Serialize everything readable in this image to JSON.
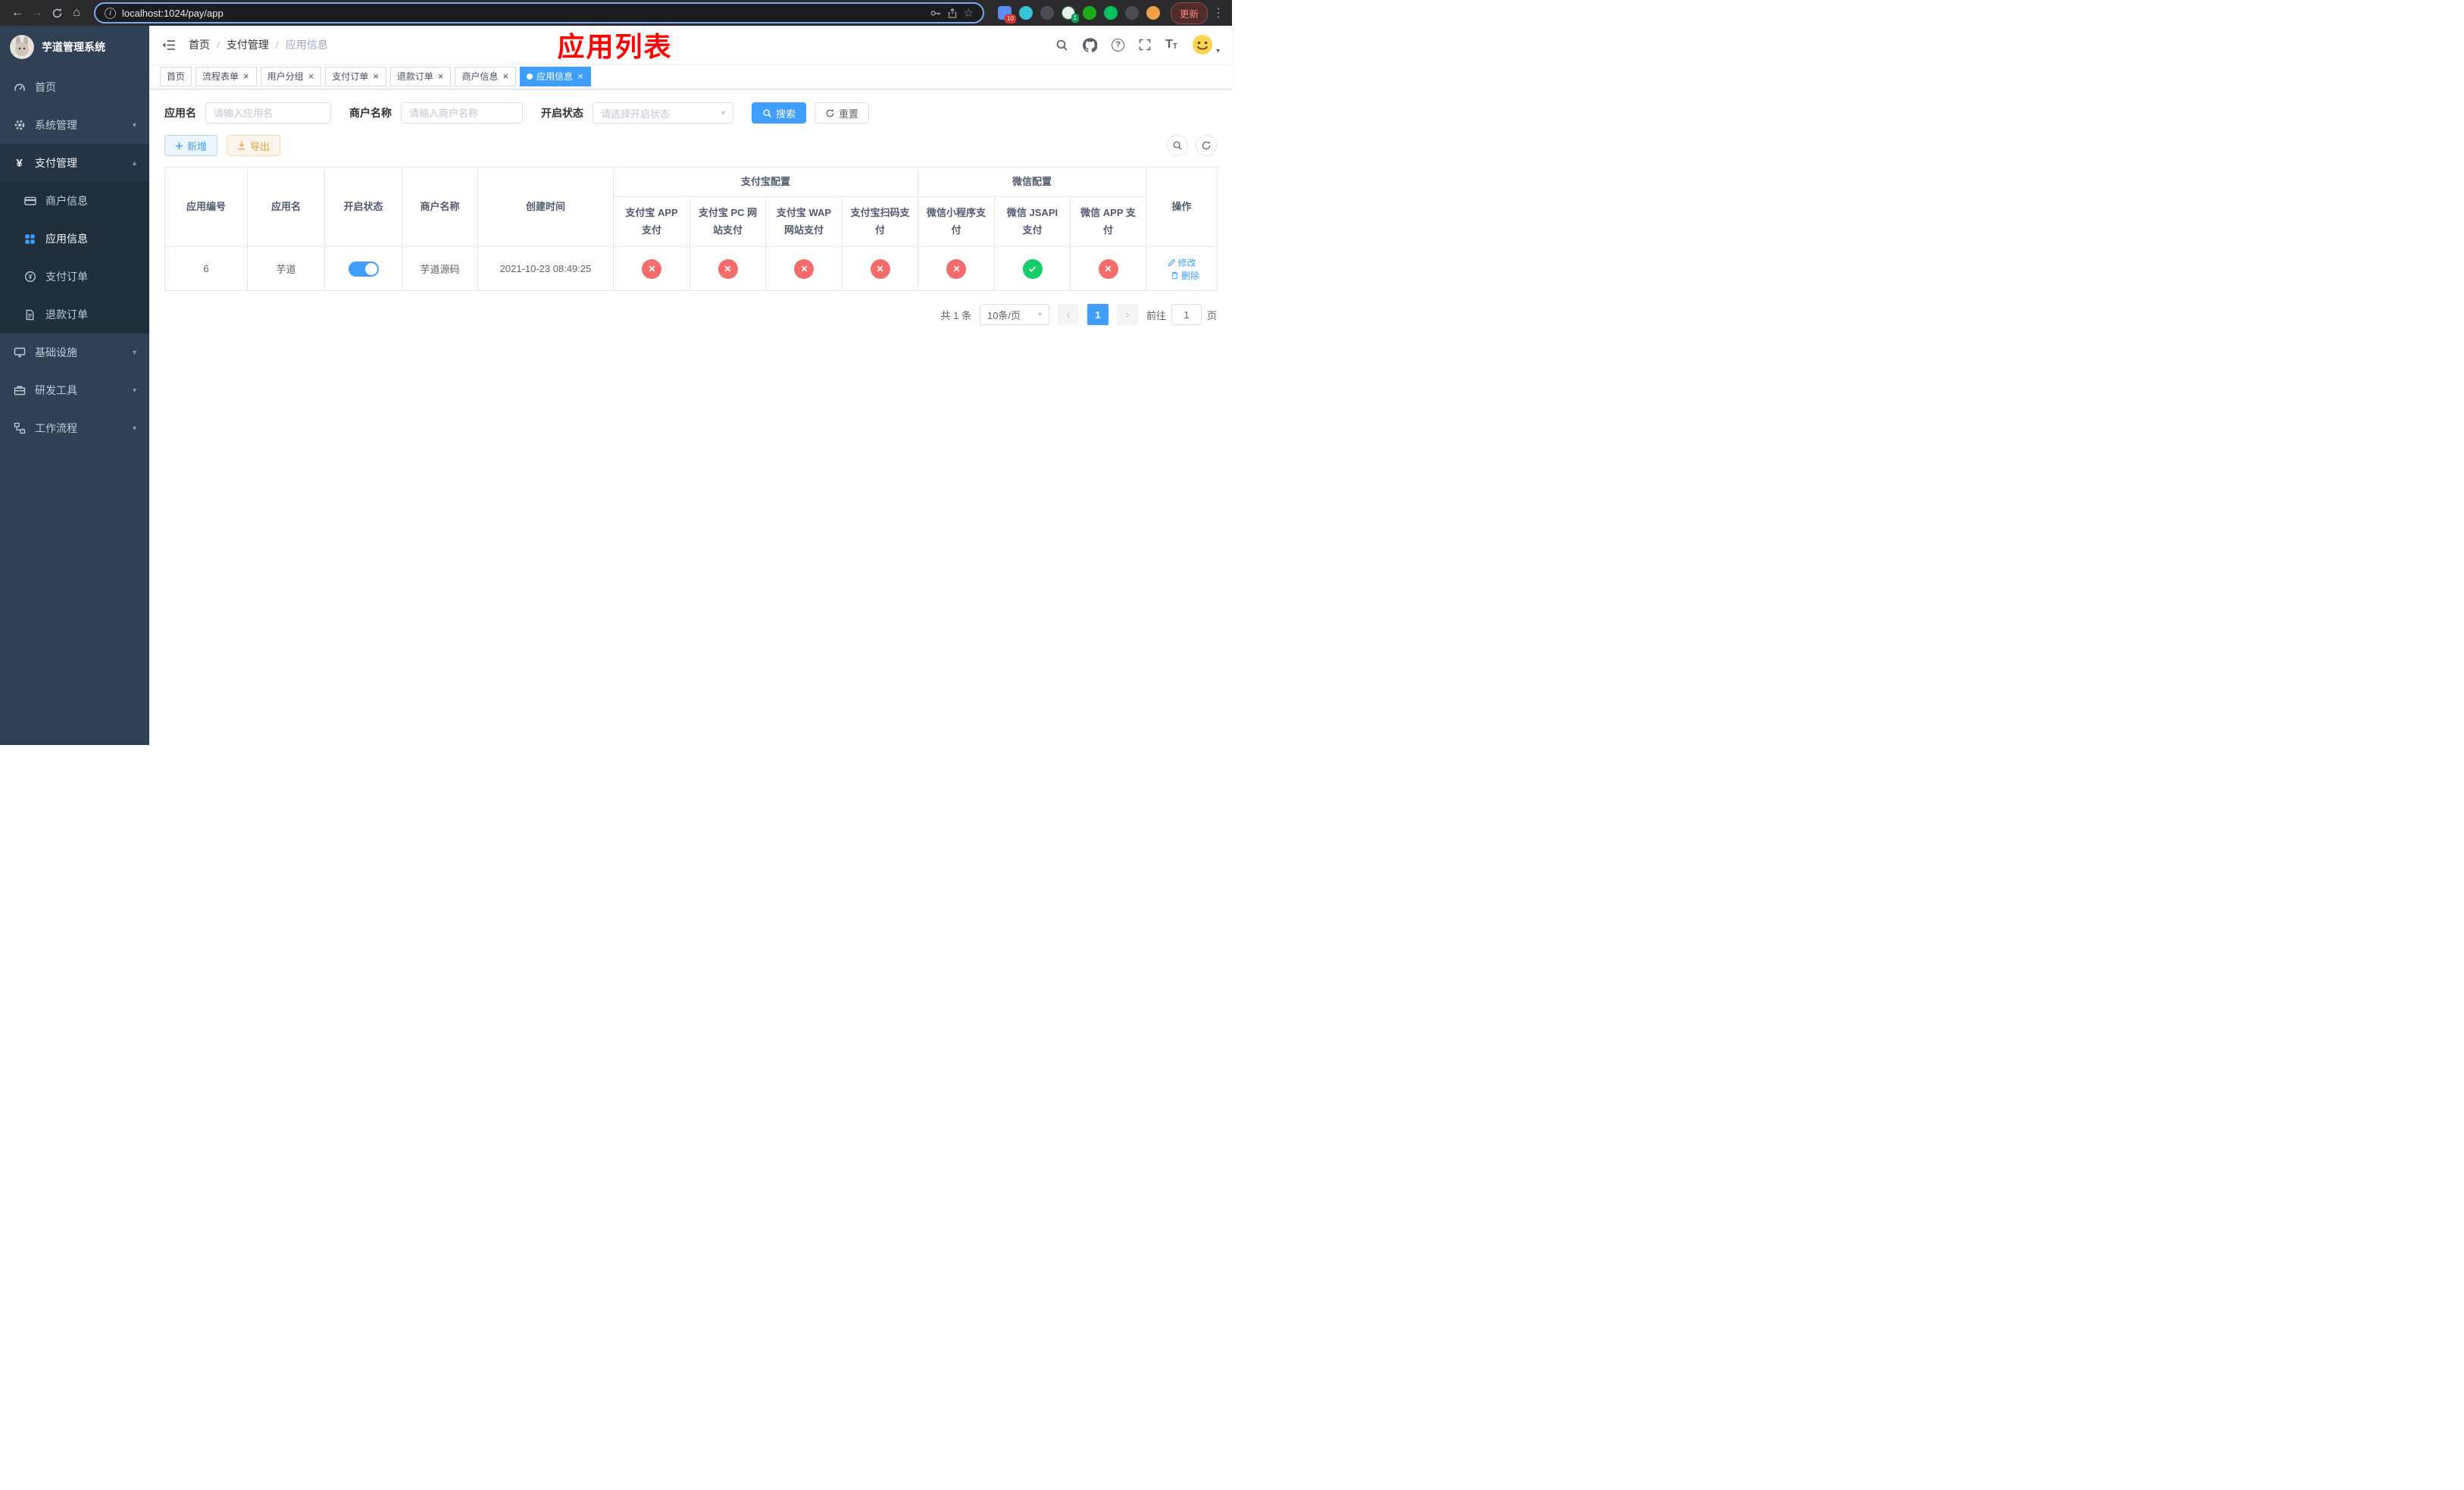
{
  "browser": {
    "url": "localhost:1024/pay/app",
    "update_button": "更新",
    "extension_badge_puzzle": "10",
    "extension_badge_wechat": "1"
  },
  "icons": {
    "back": "←",
    "forward": "→",
    "home": "⌂",
    "info": "i",
    "star": "☆",
    "kebab": "⋮",
    "breadcrumb_sep": "/",
    "question": "?",
    "font_large": "T",
    "font_small": "T",
    "caret": "▾",
    "chevron_down": "▾",
    "chevron_up": "▴",
    "close": "×",
    "prev": "‹",
    "next": "›",
    "yen": "¥"
  },
  "sidebar": {
    "logo_title": "芋道管理系统",
    "home": "首页",
    "system": "系统管理",
    "pay": "支付管理",
    "merchant": "商户信息",
    "app_info": "应用信息",
    "pay_order": "支付订单",
    "refund_order": "退款订单",
    "infra": "基础设施",
    "devtools": "研发工具",
    "workflow": "工作流程"
  },
  "header": {
    "breadcrumb": [
      "首页",
      "支付管理",
      "应用信息"
    ],
    "annotation_title": "应用列表"
  },
  "tabs": [
    {
      "label": "首页",
      "closable": false,
      "active": false
    },
    {
      "label": "流程表单",
      "closable": true,
      "active": false
    },
    {
      "label": "用户分组",
      "closable": true,
      "active": false
    },
    {
      "label": "支付订单",
      "closable": true,
      "active": false
    },
    {
      "label": "退款订单",
      "closable": true,
      "active": false
    },
    {
      "label": "商户信息",
      "closable": true,
      "active": false
    },
    {
      "label": "应用信息",
      "closable": true,
      "active": true
    }
  ],
  "filters": {
    "app_name_label": "应用名",
    "app_name_placeholder": "请输入应用名",
    "merchant_label": "商户名称",
    "merchant_placeholder": "请输入商户名称",
    "status_label": "开启状态",
    "status_placeholder": "请选择开启状态",
    "search_button": "搜索",
    "reset_button": "重置"
  },
  "toolbar": {
    "add_button": "新增",
    "export_button": "导出"
  },
  "table": {
    "columns": [
      "应用编号",
      "应用名",
      "开启状态",
      "商户名称",
      "创建时间"
    ],
    "group_alipay": "支付宝配置",
    "group_wechat": "微信配置",
    "alipay_columns": [
      "支付宝 APP 支付",
      "支付宝 PC 网站支付",
      "支付宝 WAP 网站支付",
      "支付宝扫码支付"
    ],
    "wechat_columns": [
      "微信小程序支付",
      "微信 JSAPI 支付",
      "微信 APP 支付"
    ],
    "ops_column": "操作",
    "rows": [
      {
        "id": "6",
        "name": "芋道",
        "enabled": true,
        "merchant": "芋道源码",
        "created": "2021-10-23 08:49:25",
        "statuses": [
          "fail",
          "fail",
          "fail",
          "fail",
          "fail",
          "success",
          "fail"
        ],
        "edit_label": "修改",
        "delete_label": "删除"
      }
    ]
  },
  "pagination": {
    "total_text": "共 1 条",
    "page_size": "10条/页",
    "current_page": "1",
    "goto_prefix": "前往",
    "goto_value": "1",
    "goto_suffix": "页"
  },
  "colors": {
    "accent": "#409eff",
    "danger": "#f56c6c",
    "success": "#13ce66",
    "warning": "#e6a23c",
    "annotation": "#ff0000",
    "sidebar_bg": "#304156",
    "submenu_bg": "#1f2d3d"
  }
}
